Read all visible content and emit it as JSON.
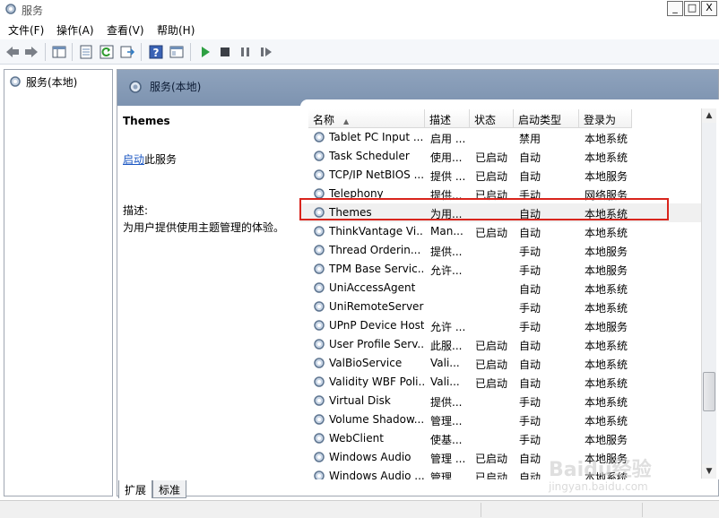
{
  "window": {
    "title": "服务",
    "minimize": "_",
    "maximize": "□",
    "close": "X"
  },
  "menu": [
    "文件(F)",
    "操作(A)",
    "查看(V)",
    "帮助(H)"
  ],
  "toolbar_icons": [
    "back-icon",
    "forward-icon",
    "console-tree-icon",
    "properties-icon",
    "refresh-icon",
    "export-icon",
    "help-icon",
    "view-icon",
    "start-service-icon",
    "stop-service-icon",
    "pause-service-icon",
    "restart-service-icon"
  ],
  "tree": {
    "root_label": "服务(本地)"
  },
  "panel_header": {
    "title": "服务(本地)"
  },
  "description": {
    "service_name": "Themes",
    "start_link": "启动",
    "start_suffix": "此服务",
    "label": "描述:",
    "text": "为用户提供使用主题管理的体验。"
  },
  "columns": [
    "名称",
    "描述",
    "状态",
    "启动类型",
    "登录为"
  ],
  "services": [
    {
      "name": "Tablet PC Input ...",
      "desc": "启用 ...",
      "status": "",
      "startup": "禁用",
      "logon": "本地系统"
    },
    {
      "name": "Task Scheduler",
      "desc": "使用...",
      "status": "已启动",
      "startup": "自动",
      "logon": "本地系统"
    },
    {
      "name": "TCP/IP NetBIOS ...",
      "desc": "提供 ...",
      "status": "已启动",
      "startup": "自动",
      "logon": "本地服务"
    },
    {
      "name": "Telephony",
      "desc": "提供...",
      "status": "已启动",
      "startup": "手动",
      "logon": "网络服务"
    },
    {
      "name": "Themes",
      "desc": "为用...",
      "status": "",
      "startup": "自动",
      "logon": "本地系统"
    },
    {
      "name": "ThinkVantage Vi...",
      "desc": "Man...",
      "status": "已启动",
      "startup": "自动",
      "logon": "本地系统"
    },
    {
      "name": "Thread Orderin...",
      "desc": "提供...",
      "status": "",
      "startup": "手动",
      "logon": "本地服务"
    },
    {
      "name": "TPM Base Servic...",
      "desc": "允许...",
      "status": "",
      "startup": "手动",
      "logon": "本地服务"
    },
    {
      "name": "UniAccessAgent",
      "desc": "",
      "status": "",
      "startup": "自动",
      "logon": "本地系统"
    },
    {
      "name": "UniRemoteServer",
      "desc": "",
      "status": "",
      "startup": "手动",
      "logon": "本地系统"
    },
    {
      "name": "UPnP Device Host",
      "desc": "允许 ...",
      "status": "",
      "startup": "手动",
      "logon": "本地服务"
    },
    {
      "name": "User Profile Serv...",
      "desc": "此服...",
      "status": "已启动",
      "startup": "自动",
      "logon": "本地系统"
    },
    {
      "name": "ValBioService",
      "desc": "Vali...",
      "status": "已启动",
      "startup": "自动",
      "logon": "本地系统"
    },
    {
      "name": "Validity WBF Poli...",
      "desc": "Vali...",
      "status": "已启动",
      "startup": "自动",
      "logon": "本地系统"
    },
    {
      "name": "Virtual Disk",
      "desc": "提供...",
      "status": "",
      "startup": "手动",
      "logon": "本地系统"
    },
    {
      "name": "Volume Shadow...",
      "desc": "管理...",
      "status": "",
      "startup": "手动",
      "logon": "本地系统"
    },
    {
      "name": "WebClient",
      "desc": "使基...",
      "status": "",
      "startup": "手动",
      "logon": "本地服务"
    },
    {
      "name": "Windows Audio",
      "desc": "管理 ...",
      "status": "已启动",
      "startup": "自动",
      "logon": "本地服务"
    },
    {
      "name": "Windows Audio ...",
      "desc": "管理 ...",
      "status": "已启动",
      "startup": "自动",
      "logon": "本地系统"
    }
  ],
  "selected_service": "Themes",
  "tabs": [
    "扩展",
    "标准"
  ],
  "watermark": {
    "main": "Baidu经验",
    "sub": "jingyan.baidu.com"
  },
  "colors": {
    "highlight": "#d9241c",
    "header": "#8fa3bd",
    "link": "#1a56c2"
  }
}
